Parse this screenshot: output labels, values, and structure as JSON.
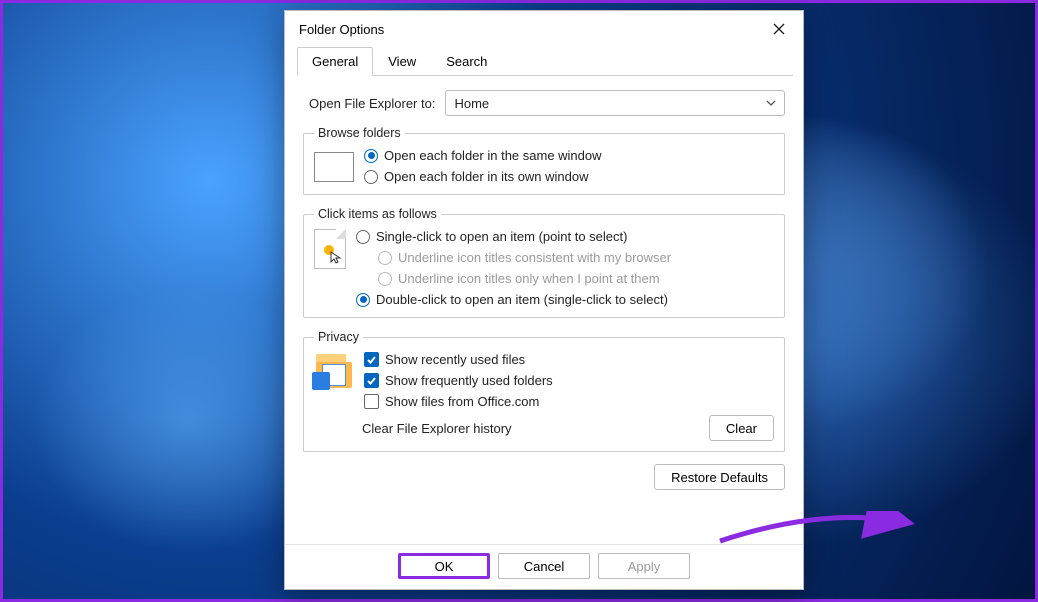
{
  "dialog": {
    "title": "Folder Options",
    "tabs": [
      "General",
      "View",
      "Search"
    ],
    "active_tab": 0
  },
  "open_to": {
    "label": "Open File Explorer to:",
    "value": "Home"
  },
  "browse": {
    "legend": "Browse folders",
    "same_window": "Open each folder in the same window",
    "own_window": "Open each folder in its own window",
    "selected": "same"
  },
  "click": {
    "legend": "Click items as follows",
    "single": "Single-click to open an item (point to select)",
    "underline_browser": "Underline icon titles consistent with my browser",
    "underline_point": "Underline icon titles only when I point at them",
    "double": "Double-click to open an item (single-click to select)",
    "selected": "double"
  },
  "privacy": {
    "legend": "Privacy",
    "recent_files": "Show recently used files",
    "frequent_folders": "Show frequently used folders",
    "office": "Show files from Office.com",
    "recent_checked": true,
    "frequent_checked": true,
    "office_checked": false,
    "clear_label": "Clear File Explorer history",
    "clear_button": "Clear"
  },
  "restore": "Restore Defaults",
  "footer": {
    "ok": "OK",
    "cancel": "Cancel",
    "apply": "Apply"
  }
}
